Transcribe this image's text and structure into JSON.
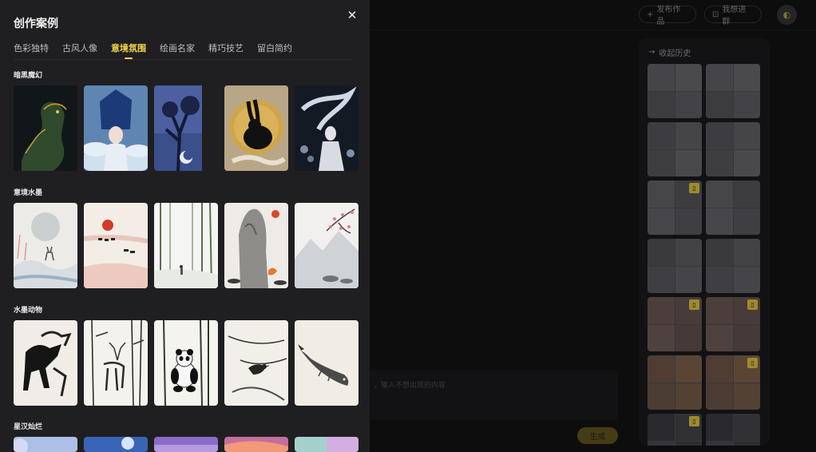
{
  "modal": {
    "title": "创作案例",
    "close_label": "✕",
    "tabs": [
      {
        "label": "色彩独特",
        "active": false
      },
      {
        "label": "古风人像",
        "active": false
      },
      {
        "label": "意境氛围",
        "active": true
      },
      {
        "label": "绘画名家",
        "active": false
      },
      {
        "label": "精巧技艺",
        "active": false
      },
      {
        "label": "留白简约",
        "active": false
      }
    ],
    "sections": [
      {
        "title": "暗黑魔幻",
        "items": [
          "dark-dragon",
          "blue-phoenix-lady",
          "moon-tree",
          "golden-rabbit-moon",
          "white-dragon-girl"
        ]
      },
      {
        "title": "意境水墨",
        "items": [
          "misty-deer",
          "red-sun-horses",
          "bamboo-forest",
          "rock-fox",
          "plum-blossom-mountain"
        ]
      },
      {
        "title": "水墨动物",
        "items": [
          "galloping-horses",
          "deer-in-bamboo",
          "panda-bamboo",
          "bird-on-branch",
          "ink-fish"
        ]
      },
      {
        "title": "星汉灿烂",
        "items": [
          "starry-1",
          "starry-2",
          "starry-3",
          "starry-4",
          "starry-5"
        ]
      }
    ]
  },
  "background": {
    "publish_label": "发布作品",
    "join_label": "我想进群",
    "history_label": "收起历史",
    "prompt_placeholder": "，输入不想出现的内容",
    "generate_label": "生成"
  },
  "colors": {
    "accent": "#f3d547",
    "panel": "#1f1f22"
  }
}
